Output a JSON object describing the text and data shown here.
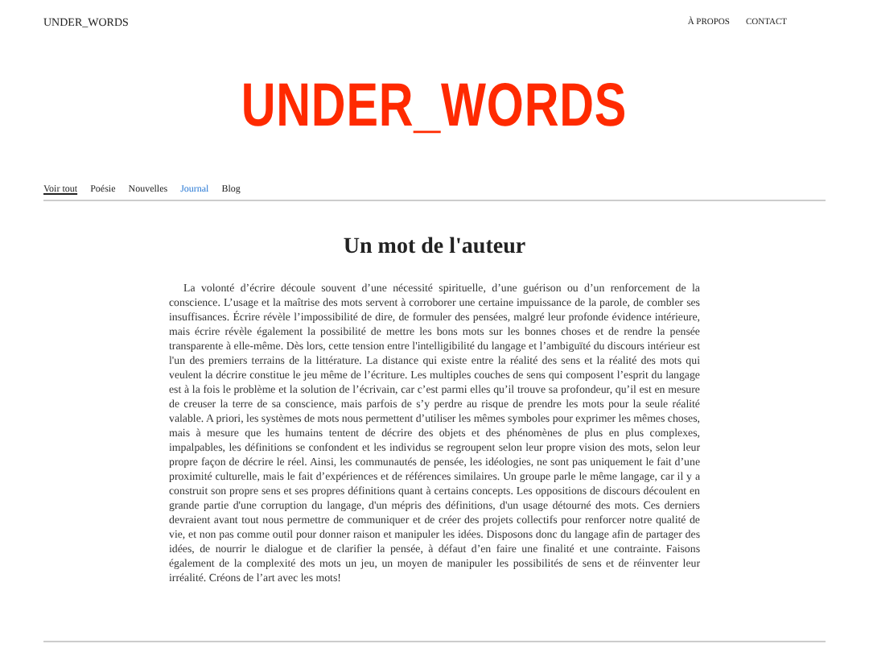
{
  "header": {
    "brand": "UNDER_WORDS",
    "nav": [
      "À PROPOS",
      "CONTACT"
    ]
  },
  "logo": "UNDER_WORDS",
  "categories": [
    {
      "label": "Voir tout",
      "selected": true,
      "highlighted": false
    },
    {
      "label": "Poésie",
      "selected": false,
      "highlighted": false
    },
    {
      "label": "Nouvelles",
      "selected": false,
      "highlighted": false
    },
    {
      "label": "Journal",
      "selected": false,
      "highlighted": true
    },
    {
      "label": "Blog",
      "selected": false,
      "highlighted": false
    }
  ],
  "article": {
    "title": "Un mot de l'auteur",
    "body": "La volonté d’écrire découle souvent d’une nécessité spirituelle, d’une guérison ou d’un renforcement de la conscience. L’usage et la maîtrise des mots servent à corroborer une certaine impuissance de la parole, de combler ses insuffisances. Écrire révèle l’impossibilité de dire, de formuler des pensées, malgré leur profonde évidence intérieure, mais écrire révèle également la possibilité de mettre les bons mots sur les bonnes choses et de rendre la pensée transparente à elle-même. Dès lors, cette tension entre l'intelligibilité du langage et l’ambiguïté du discours intérieur est l'un des premiers terrains de la littérature. La distance qui existe entre la réalité des sens et la réalité des mots qui veulent la décrire constitue le jeu même de l’écriture. Les multiples couches de sens qui composent l’esprit du langage est à la fois le problème et la solution de l’écrivain, car c’est parmi elles qu’il trouve sa profondeur, qu’il est en mesure de creuser la terre de sa conscience, mais parfois de s’y perdre au risque de prendre les mots pour la seule réalité valable. A priori, les systèmes de mots nous permettent d’utiliser les mêmes symboles pour exprimer les mêmes choses, mais à mesure que les humains tentent de décrire des objets et des phénomènes de plus en plus complexes, impalpables, les définitions se confondent et les individus se regroupent selon leur propre vision des mots, selon leur propre façon de décrire le réel. Ainsi, les communautés de pensée, les idéologies, ne sont pas uniquement le fait d’une proximité culturelle, mais le fait d’expériences et de références similaires. Un groupe parle le même langage, car il y a construit son propre sens et ses propres définitions quant à certains concepts. Les oppositions de discours découlent en grande partie d'une corruption du langage, d'un mépris des définitions, d'un usage détourné des mots. Ces derniers devraient avant tout nous permettre de communiquer et de créer des projets collectifs pour renforcer notre qualité de vie, et non pas comme outil pour donner raison et manipuler les idées. Disposons donc du langage afin de partager des idées, de nourrir le dialogue et de clarifier la pensée, à défaut d’en faire une finalité et une contrainte. Faisons également de la complexité des mots un jeu, un moyen de manipuler les possibilités de sens et de réinventer leur irréalité. Créons de l’art avec les mots!"
  }
}
